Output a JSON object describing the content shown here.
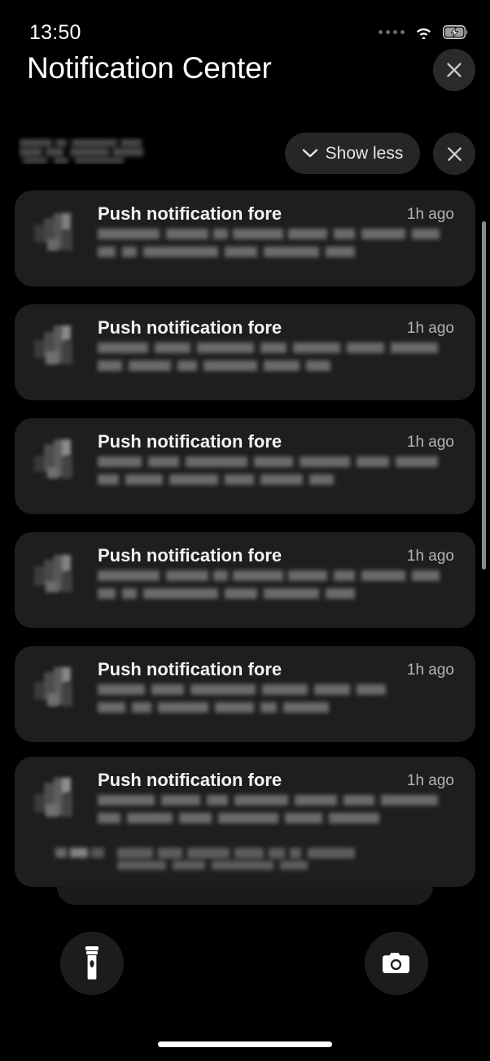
{
  "status_bar": {
    "time": "13:50",
    "signal_icon": "cellular-dots-icon",
    "signal_dots": 4,
    "wifi_icon": "wifi-icon",
    "battery_icon": "battery-charging-icon",
    "battery_charging": true
  },
  "header": {
    "title": "Notification Center",
    "close_icon": "close-icon"
  },
  "group": {
    "title_redacted": "",
    "show_less_label": "Show less",
    "show_less_icon": "chevron-down-icon",
    "clear_icon": "close-icon"
  },
  "notifications": [
    {
      "title": "Push notification fore",
      "time": "1h ago",
      "body_redacted": "",
      "app_icon": "app-icon-redacted"
    },
    {
      "title": "Push notification fore",
      "time": "1h ago",
      "body_redacted": "",
      "app_icon": "app-icon-redacted"
    },
    {
      "title": "Push notification fore",
      "time": "1h ago",
      "body_redacted": "",
      "app_icon": "app-icon-redacted"
    },
    {
      "title": "Push notification fore",
      "time": "1h ago",
      "body_redacted": "",
      "app_icon": "app-icon-redacted"
    },
    {
      "title": "Push notification fore",
      "time": "1h ago",
      "body_redacted": "",
      "app_icon": "app-icon-redacted"
    },
    {
      "title": "Push notification fore",
      "time": "1h ago",
      "body_redacted": "",
      "app_icon": "app-icon-redacted"
    }
  ],
  "shortcuts": {
    "flashlight_icon": "flashlight-icon",
    "camera_icon": "camera-icon"
  },
  "system": {
    "home_indicator": "home-indicator"
  },
  "colors": {
    "background": "#000000",
    "card": "#1e1e1e",
    "pill": "#262626",
    "text_primary": "#f2f2f2",
    "text_secondary": "#b4b4b4",
    "scrollbar": "#8a8a8a"
  }
}
